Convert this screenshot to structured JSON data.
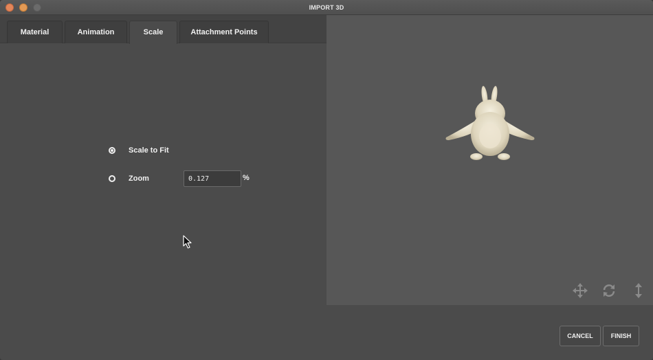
{
  "window": {
    "title": "IMPORT 3D"
  },
  "tabs": [
    {
      "label": "Material",
      "active": false
    },
    {
      "label": "Animation",
      "active": false
    },
    {
      "label": "Scale",
      "active": true
    },
    {
      "label": "Attachment Points",
      "active": false
    }
  ],
  "scale": {
    "options": [
      {
        "label": "Scale to Fit",
        "selected": true
      },
      {
        "label": "Zoom",
        "selected": false
      }
    ],
    "zoom_value": "0.127",
    "zoom_unit": "%"
  },
  "preview": {
    "controls": [
      "move-icon",
      "rotate-icon",
      "vertical-height-icon"
    ]
  },
  "footer": {
    "cancel_label": "CANCEL",
    "finish_label": "FINISH"
  },
  "colors": {
    "panel": "#4b4b4b",
    "preview_bg": "#575757",
    "text": "#f0f0f0",
    "close_button": "#e3865a",
    "minimize_button": "#e39a55"
  }
}
